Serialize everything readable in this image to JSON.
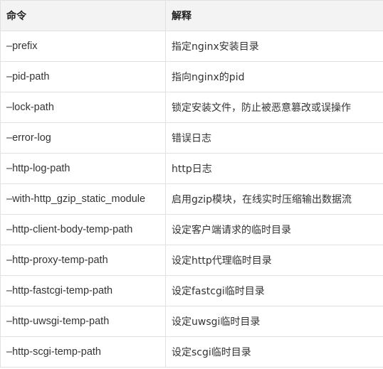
{
  "table": {
    "headers": [
      "命令",
      "解释"
    ],
    "rows": [
      {
        "option": "–prefix",
        "description": "指定nginx安装目录"
      },
      {
        "option": "–pid-path",
        "description": "指向nginx的pid"
      },
      {
        "option": "–lock-path",
        "description": "锁定安装文件，防止被恶意篡改或误操作"
      },
      {
        "option": "–error-log",
        "description": "错误日志"
      },
      {
        "option": "–http-log-path",
        "description": "http日志"
      },
      {
        "option": "–with-http_gzip_static_module",
        "description": "启用gzip模块，在线实时压缩输出数据流"
      },
      {
        "option": "–http-client-body-temp-path",
        "description": "设定客户端请求的临时目录"
      },
      {
        "option": "–http-proxy-temp-path",
        "description": "设定http代理临时目录"
      },
      {
        "option": "–http-fastcgi-temp-path",
        "description": "设定fastcgi临时目录"
      },
      {
        "option": "–http-uwsgi-temp-path",
        "description": "设定uwsgi临时目录"
      },
      {
        "option": "–http-scgi-temp-path",
        "description": "设定scgi临时目录"
      }
    ]
  }
}
